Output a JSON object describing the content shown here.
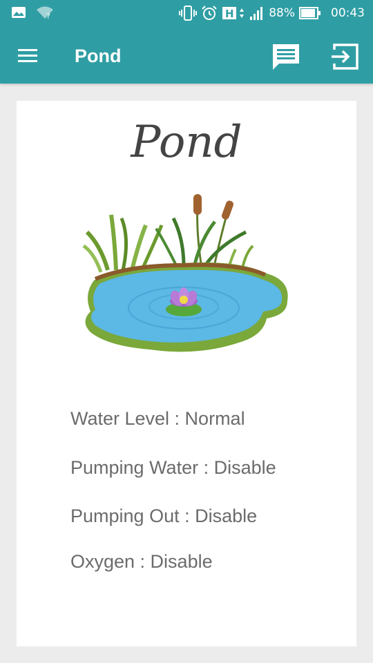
{
  "status_bar": {
    "battery": "88%",
    "time": "00:43",
    "network": "H",
    "icons": [
      "image-icon",
      "wifi-unknown-icon",
      "vibrate-icon",
      "alarm-icon",
      "signal-icon",
      "battery-icon"
    ]
  },
  "app_bar": {
    "title": "Pond",
    "icons": [
      "menu-icon",
      "chat-icon",
      "exit-icon"
    ],
    "color": "#2f9ea4"
  },
  "card": {
    "title": "Pond",
    "image": "pond-illustration",
    "items": [
      {
        "text": "Water Level : Normal"
      },
      {
        "text": "Pumping Water : Disable"
      },
      {
        "text": "Pumping Out : Disable"
      },
      {
        "text": "Oxygen : Disable"
      }
    ]
  }
}
